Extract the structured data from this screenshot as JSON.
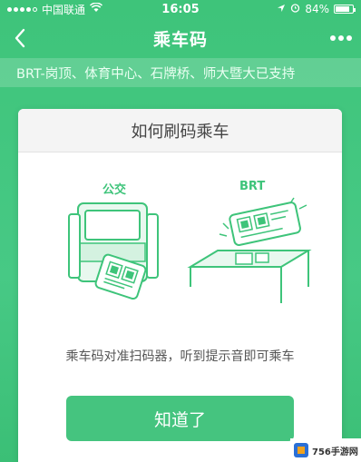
{
  "status_bar": {
    "carrier": "中国联通",
    "time": "16:05",
    "battery": "84%",
    "battery_level": 0.84
  },
  "nav": {
    "title": "乘车码"
  },
  "banner": {
    "text": "BRT-岗顶、体育中心、石牌桥、师大暨大已支持"
  },
  "card": {
    "title": "如何刷码乘车",
    "bus_label": "公交",
    "brt_label": "BRT",
    "hint": "乘车码对准扫码器，听到提示音即可乘车",
    "ok_label": "知道了"
  },
  "watermark": {
    "text": "756手游网"
  },
  "colors": {
    "brand_green": "#3ec47a",
    "button_green": "#45c47f"
  }
}
